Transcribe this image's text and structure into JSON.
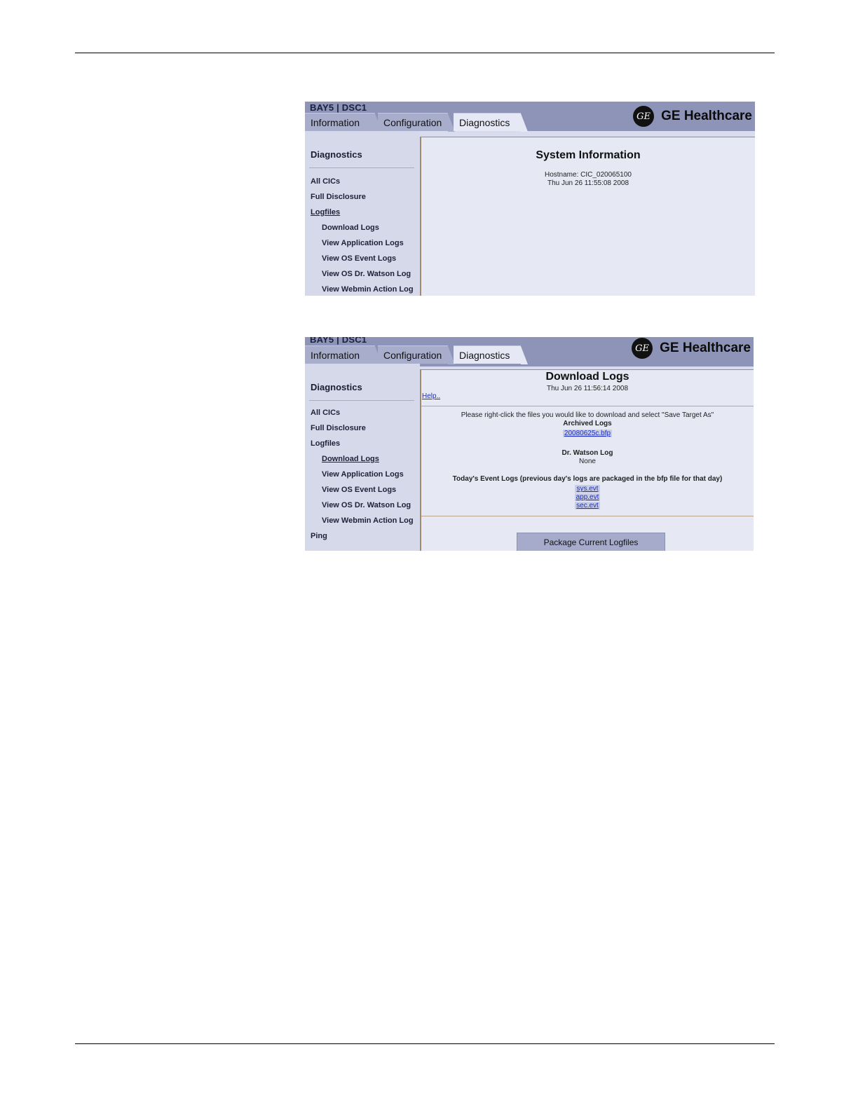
{
  "screen1": {
    "crumb": "BAY5 | DSC1",
    "tabs": [
      "Information",
      "Configuration",
      "Diagnostics"
    ],
    "brand": "GE Healthcare",
    "sidebar": {
      "title": "Diagnostics",
      "items": [
        "All CICs",
        "Full Disclosure",
        "Logfiles",
        "Download Logs",
        "View Application Logs",
        "View OS Event Logs",
        "View OS Dr. Watson Log",
        "View Webmin Action Log"
      ]
    },
    "main": {
      "title": "System Information",
      "hostname": "Hostname: CIC_020065100",
      "date": "Thu Jun 26 11:55:08 2008"
    }
  },
  "screen2": {
    "crumb": "BAY5 | DSC1",
    "tabs": [
      "Information",
      "Configuration",
      "Diagnostics"
    ],
    "brand": "GE Healthcare",
    "sidebar": {
      "title": "Diagnostics",
      "items": [
        "All CICs",
        "Full Disclosure",
        "Logfiles",
        "Download Logs",
        "View Application Logs",
        "View OS Event Logs",
        "View OS Dr. Watson Log",
        "View Webmin Action Log",
        "Ping"
      ]
    },
    "main": {
      "title": "Download Logs",
      "date": "Thu Jun 26 11:56:14 2008",
      "help": "Help..",
      "instruction": "Please right-click the files you would like to download and select \"Save Target As\"",
      "archived_label": "Archived Logs",
      "archived_file": "20080625c.bfp",
      "watson_label": "Dr. Watson Log",
      "watson_value": "None",
      "event_label": "Today's Event Logs (previous day's logs are packaged in the bfp file for that day)",
      "event_files": [
        "sys.evt",
        "app.evt",
        "sec.evt"
      ],
      "package_button": "Package Current Logfiles"
    }
  }
}
